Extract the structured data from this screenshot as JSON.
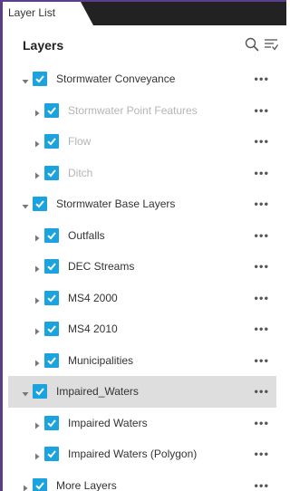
{
  "tab": {
    "label": "Layer List"
  },
  "header": {
    "title": "Layers"
  },
  "layers": [
    {
      "label": "Stormwater Conveyance",
      "level": 0,
      "expanded": true,
      "checked": true,
      "dim": false,
      "selected": false
    },
    {
      "label": "Stormwater Point Features",
      "level": 1,
      "expanded": false,
      "checked": true,
      "dim": true,
      "selected": false
    },
    {
      "label": "Flow",
      "level": 1,
      "expanded": false,
      "checked": true,
      "dim": true,
      "selected": false
    },
    {
      "label": "Ditch",
      "level": 1,
      "expanded": false,
      "checked": true,
      "dim": true,
      "selected": false
    },
    {
      "label": "Stormwater Base Layers",
      "level": 0,
      "expanded": true,
      "checked": true,
      "dim": false,
      "selected": false
    },
    {
      "label": "Outfalls",
      "level": 1,
      "expanded": false,
      "checked": true,
      "dim": false,
      "selected": false
    },
    {
      "label": "DEC Streams",
      "level": 1,
      "expanded": false,
      "checked": true,
      "dim": false,
      "selected": false
    },
    {
      "label": "MS4 2000",
      "level": 1,
      "expanded": false,
      "checked": true,
      "dim": false,
      "selected": false
    },
    {
      "label": "MS4 2010",
      "level": 1,
      "expanded": false,
      "checked": true,
      "dim": false,
      "selected": false
    },
    {
      "label": "Municipalities",
      "level": 1,
      "expanded": false,
      "checked": true,
      "dim": false,
      "selected": false
    },
    {
      "label": "Impaired_Waters",
      "level": 0,
      "expanded": true,
      "checked": true,
      "dim": false,
      "selected": true
    },
    {
      "label": "Impaired Waters",
      "level": 1,
      "expanded": false,
      "checked": true,
      "dim": false,
      "selected": false
    },
    {
      "label": "Impaired Waters (Polygon)",
      "level": 1,
      "expanded": false,
      "checked": true,
      "dim": false,
      "selected": false
    },
    {
      "label": "More Layers",
      "level": 0,
      "expanded": false,
      "checked": true,
      "dim": false,
      "selected": false
    }
  ],
  "more_glyph": "•••",
  "colors": {
    "checkbox": "#1aa3df",
    "selected_row": "#dedede",
    "frame": "#5b3e8a",
    "tabbar": "#222222"
  },
  "icons": {
    "search": "search-icon",
    "filter": "filter-list-icon",
    "expand": "caret-down-icon",
    "collapse": "caret-right-icon",
    "check": "check-icon",
    "more": "more-options-icon"
  }
}
